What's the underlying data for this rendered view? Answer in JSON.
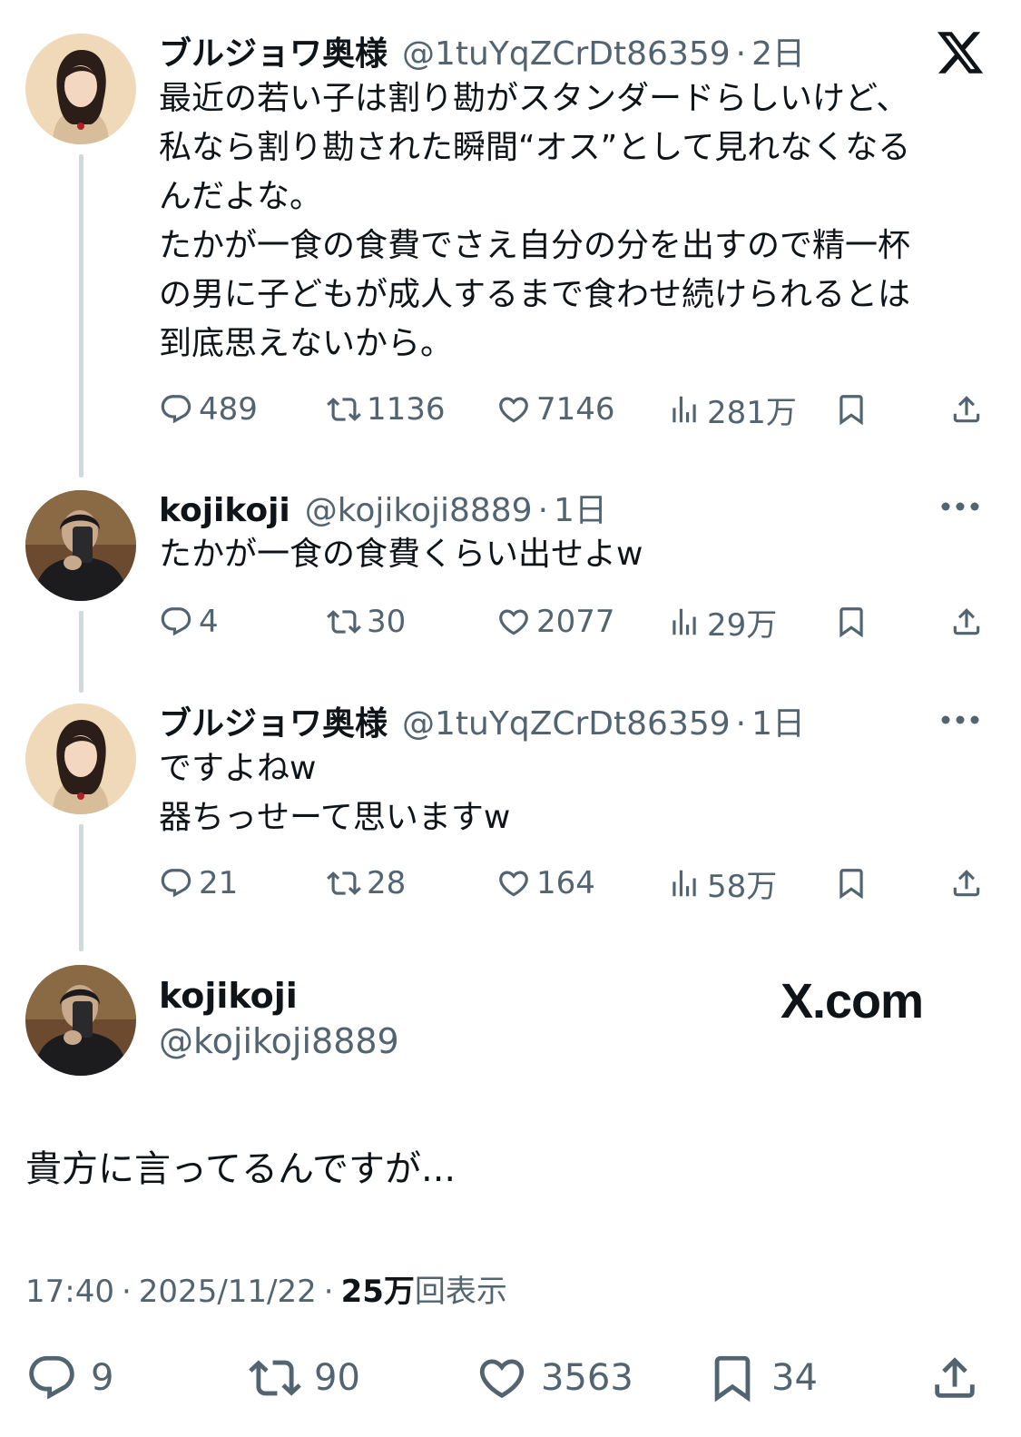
{
  "colors": {
    "text": "#0f1419",
    "secondary": "#536471",
    "thread_line": "#cfd9de",
    "background": "#ffffff"
  },
  "x_logo": "x-logo-icon",
  "tweets": [
    {
      "name": "ブルジョワ奥様",
      "handle": "@1tuYqZCrDt86359",
      "sep": "·",
      "time": "2日",
      "lines": [
        "最近の若い子は割り勘がスタンダードらしいけど、",
        "私なら割り勘された瞬間“オス”として見れなくなる",
        "んだよな。",
        "たかが一食の食費でさえ自分の分を出すので精一杯",
        "の男に子どもが成人するまで食わせ続けられるとは",
        "到底思えないから。"
      ],
      "replies": "489",
      "retweets": "1136",
      "likes": "7146",
      "views": "281万"
    },
    {
      "name": "kojikoji",
      "handle": "@kojikoji8889",
      "sep": "·",
      "time": "1日",
      "lines": [
        "たかが一食の食費くらい出せよw"
      ],
      "replies": "4",
      "retweets": "30",
      "likes": "2077",
      "views": "29万"
    },
    {
      "name": "ブルジョワ奥様",
      "handle": "@1tuYqZCrDt86359",
      "sep": "·",
      "time": "1日",
      "lines": [
        "ですよねw",
        "器ちっせーて思いますw"
      ],
      "replies": "21",
      "retweets": "28",
      "likes": "164",
      "views": "58万"
    }
  ],
  "main": {
    "name": "kojikoji",
    "handle": "@kojikoji8889",
    "brand": "X.com",
    "text": "貴方に言ってるんですが...",
    "time": "17:40",
    "date": "2025/11/22",
    "sep": "·",
    "views_count": "25万",
    "views_label": "回表示",
    "replies": "9",
    "retweets": "90",
    "likes": "3563",
    "bookmarks": "34"
  }
}
